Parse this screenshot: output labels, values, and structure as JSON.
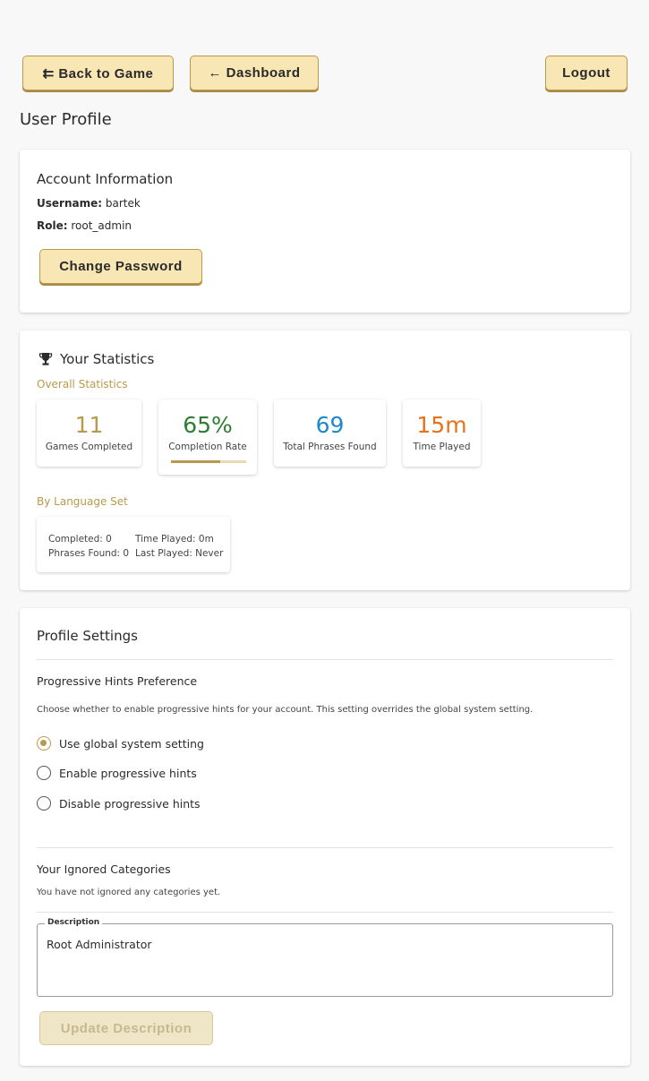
{
  "nav": {
    "back_label": "⇇ Back to Game",
    "dashboard_label": "← Dashboard",
    "logout_label": "Logout"
  },
  "page_title": "User Profile",
  "account": {
    "title": "Account Information",
    "username_label": "Username:",
    "username": "bartek",
    "role_label": "Role:",
    "role": "root_admin",
    "change_password_label": "Change Password"
  },
  "statistics": {
    "title": "Your Statistics",
    "icon": "trophy-icon",
    "overall_label": "Overall Statistics",
    "stats": [
      {
        "value": "11",
        "label": "Games Completed",
        "color": "#b89a4c"
      },
      {
        "value": "65%",
        "label": "Completion Rate",
        "color": "#2e7d32",
        "progress": 0.65
      },
      {
        "value": "69",
        "label": "Total Phrases Found",
        "color": "#1e88c8"
      },
      {
        "value": "15m",
        "label": "Time Played",
        "color": "#e8711c"
      }
    ],
    "by_language_label": "By Language Set",
    "language_set": {
      "completed": "Completed: 0",
      "time_played": "Time Played: 0m",
      "phrases_found": "Phrases Found: 0",
      "last_played": "Last Played: Never"
    }
  },
  "settings": {
    "title": "Profile Settings",
    "hints_title": "Progressive Hints Preference",
    "hints_description": "Choose whether to enable progressive hints for your account. This setting overrides the global system setting.",
    "options": [
      {
        "label": "Use global system setting",
        "checked": true
      },
      {
        "label": "Enable progressive hints",
        "checked": false
      },
      {
        "label": "Disable progressive hints",
        "checked": false
      }
    ],
    "ignored_title": "Your Ignored Categories",
    "ignored_text": "You have not ignored any categories yet.",
    "description_legend": "Description",
    "description_value": "Root Administrator",
    "update_label": "Update Description"
  },
  "colors": {
    "accent": "#b89a4c",
    "button_bg": "#f8e6b4"
  }
}
